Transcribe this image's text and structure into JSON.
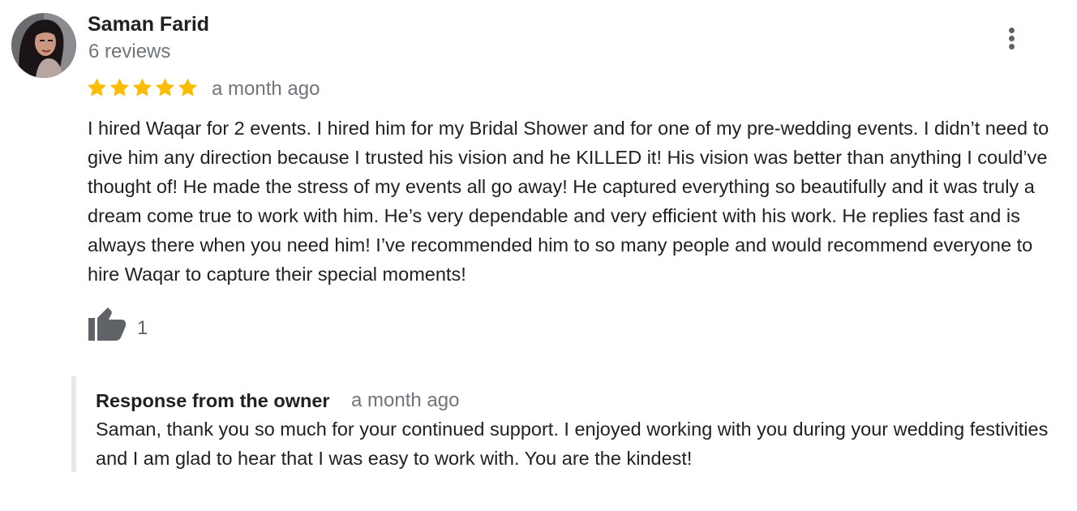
{
  "reviewer": {
    "name": "Saman Farid",
    "review_count": "6 reviews",
    "avatar_icon": "reviewer-avatar-photo"
  },
  "review": {
    "rating": 5,
    "max_rating": 5,
    "star_color": "#fbbc04",
    "time": "a month ago",
    "text": "I hired Waqar for 2 events. I hired him for my Bridal Shower and for one of my pre-wedding events. I didn’t need to give him any direction because I trusted his vision and he KILLED it! His vision was better than anything I could’ve thought of! He made the stress of my events all go away! He captured everything so beautifully and it was truly a dream come true to work with him. He’s very dependable and very efficient with his work. He replies fast and is always there when you need him! I’ve recommended him to so many people and would recommend everyone to hire Waqar to capture their special moments!",
    "likes": "1",
    "like_icon": "thumbs-up-icon",
    "menu_icon": "more-vertical-icon"
  },
  "owner_response": {
    "title": "Response from the owner",
    "time": "a month ago",
    "text": "Saman, thank you so much for your continued support. I enjoyed working with you during your wedding festivities and I am glad to hear that I was easy to work with. You are the kindest!"
  }
}
